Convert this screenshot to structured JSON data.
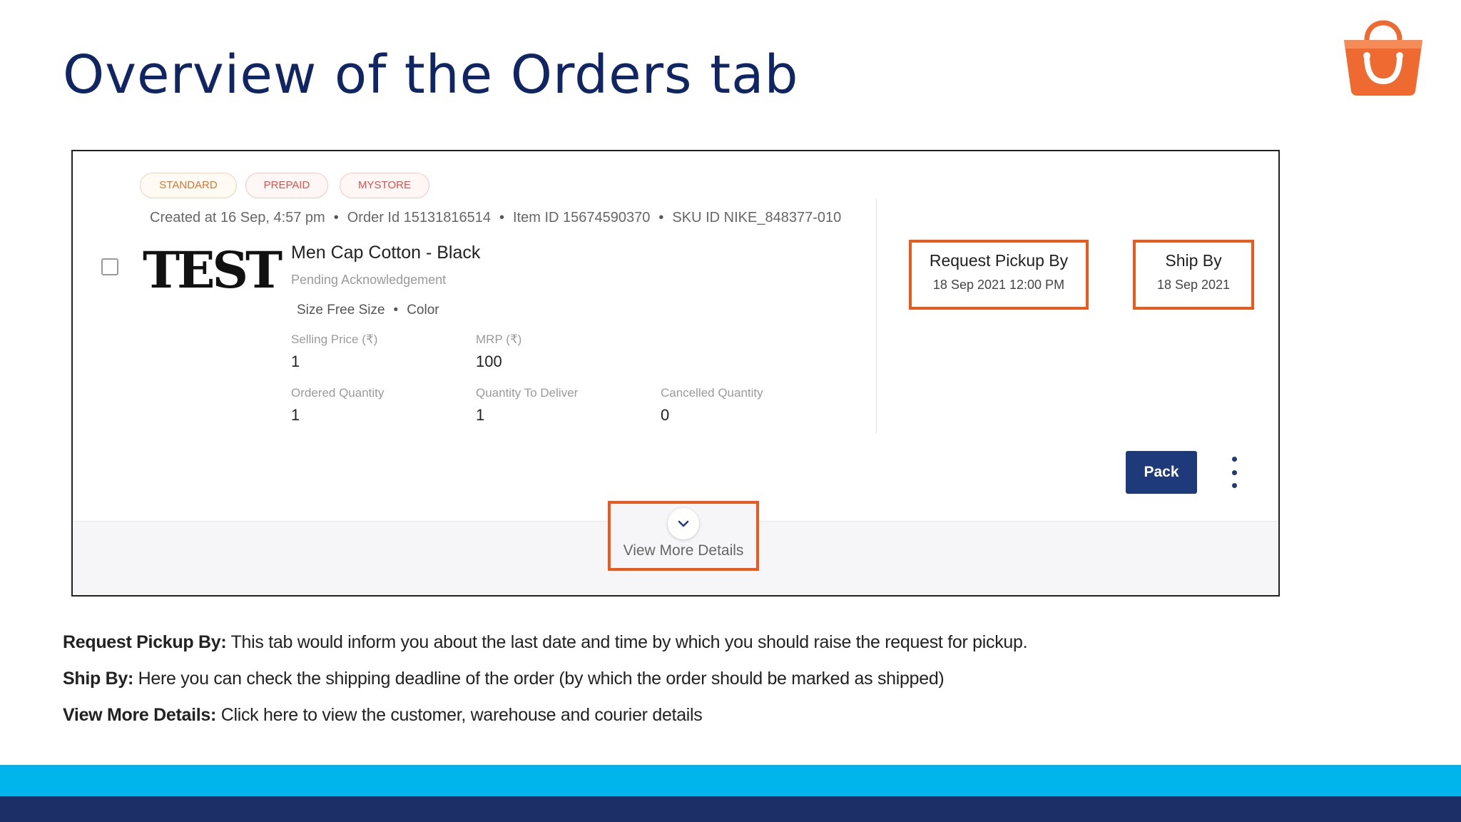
{
  "slide": {
    "title": "Overview of the Orders tab"
  },
  "colors": {
    "title": "#0f2564",
    "highlight": "#ea5a1c",
    "pack_button": "#1f3a7a",
    "band_light": "#00b5ec",
    "band_dark": "#1c2f66",
    "logo": "#ee6a31"
  },
  "order": {
    "tags": [
      "STANDARD",
      "PREPAID",
      "MYSTORE"
    ],
    "meta": {
      "created": "Created at 16 Sep, 4:57 pm",
      "order_id": "Order Id 15131816514",
      "item_id": "Item ID 15674590370",
      "sku_id": "SKU ID NIKE_848377-010"
    },
    "image_text": "TEST",
    "product_name": "Men Cap Cotton - Black",
    "status": "Pending Acknowledgement",
    "attributes": {
      "size": "Size Free Size",
      "color": "Color"
    },
    "fields": {
      "selling_price_label": "Selling Price (₹)",
      "selling_price_value": "1",
      "mrp_label": "MRP (₹)",
      "mrp_value": "100",
      "ordered_qty_label": "Ordered Quantity",
      "ordered_qty_value": "1",
      "qty_to_deliver_label": "Quantity To Deliver",
      "qty_to_deliver_value": "1",
      "cancelled_qty_label": "Cancelled Quantity",
      "cancelled_qty_value": "0"
    },
    "request_pickup": {
      "label": "Request Pickup By",
      "value": "18 Sep 2021 12:00 PM"
    },
    "ship_by": {
      "label": "Ship By",
      "value": "18 Sep 2021"
    },
    "pack_label": "Pack",
    "more_icon": "vertical-ellipsis-icon",
    "view_more_label": "View More Details",
    "view_more_icon": "chevron-down-icon"
  },
  "notes": [
    {
      "term": "Request Pickup By:",
      "text": " This tab would inform you about the last date and time by which you should raise the request for pickup."
    },
    {
      "term": "Ship By:",
      "text": " Here you can check the shipping deadline of the order (by which the order should be marked as shipped)"
    },
    {
      "term": "View More Details:",
      "text": " Click here to view the customer, warehouse and courier details"
    }
  ]
}
